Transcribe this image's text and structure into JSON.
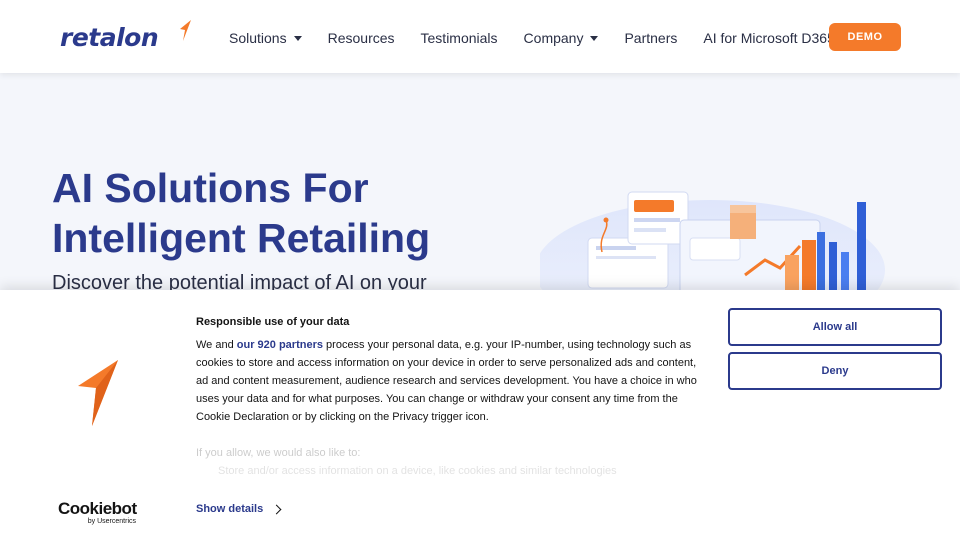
{
  "header": {
    "logo_text": "retalon",
    "nav": [
      {
        "label": "Solutions",
        "has_dropdown": true
      },
      {
        "label": "Resources",
        "has_dropdown": false
      },
      {
        "label": "Testimonials",
        "has_dropdown": false
      },
      {
        "label": "Company",
        "has_dropdown": true
      },
      {
        "label": "Partners",
        "has_dropdown": false
      },
      {
        "label": "AI for Microsoft D365",
        "has_dropdown": false
      }
    ],
    "demo_label": "DEMO"
  },
  "hero": {
    "title": "AI Solutions For Intelligent Retailing",
    "subtitle": "Discover the potential impact of AI on your"
  },
  "cookie": {
    "title": "Responsible use of your data",
    "body_prefix": "We and ",
    "body_link": "our 920 partners",
    "body_rest": " process your personal data, e.g. your IP-number, using technology such as cookies to store and access information on your device in order to serve personalized ads and content, ad and content measurement, audience research and services development. You have a choice in who uses your data and for what purposes. You can change or withdraw your consent any time from the Cookie Declaration or by clicking on the Privacy trigger icon.",
    "faded_line": "If you allow, we would also like to:",
    "faded_bullet": "Store and/or access information on a device, like cookies and similar technologies",
    "show_details_label": "Show details",
    "allow_all_label": "Allow all",
    "deny_label": "Deny",
    "brand_main": "Cookiebot",
    "brand_sub": "by Usercentrics"
  },
  "colors": {
    "brand_blue": "#2b3a8c",
    "accent_orange": "#f47a2a",
    "text_dark": "#2a2f45"
  }
}
